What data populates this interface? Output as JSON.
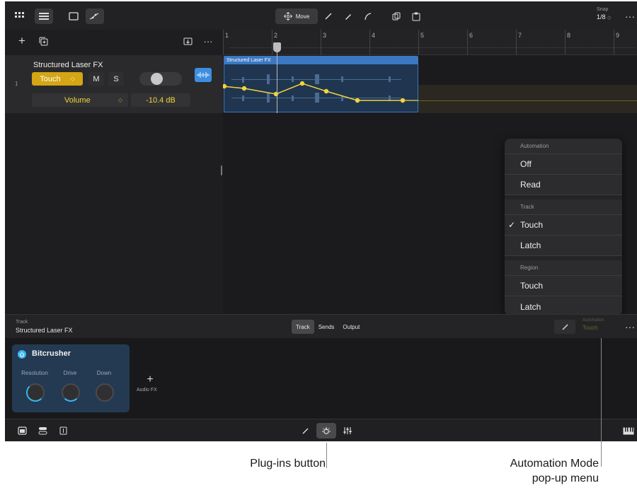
{
  "toolbar": {
    "move_label": "Move",
    "snap_label": "Snap",
    "snap_value": "1/8"
  },
  "track": {
    "number": "1",
    "name": "Structured Laser FX",
    "automation_mode": "Touch",
    "mute_label": "M",
    "solo_label": "S",
    "parameter": "Volume",
    "value": "-10.4 dB"
  },
  "ruler": {
    "bars": [
      "1",
      "2",
      "3",
      "4",
      "5",
      "6",
      "7",
      "8",
      "9"
    ]
  },
  "region": {
    "name": "Structured Laser FX"
  },
  "automation_popup": {
    "sections": [
      {
        "header": "Automation",
        "items": [
          {
            "label": "Off",
            "checked": false
          },
          {
            "label": "Read",
            "checked": false
          }
        ]
      },
      {
        "header": "Track",
        "items": [
          {
            "label": "Touch",
            "checked": true
          },
          {
            "label": "Latch",
            "checked": false
          }
        ]
      },
      {
        "header": "Region",
        "items": [
          {
            "label": "Touch",
            "checked": false
          },
          {
            "label": "Latch",
            "checked": false
          }
        ]
      }
    ],
    "checkmark": "✓"
  },
  "inspector": {
    "track_label": "Track",
    "track_name": "Structured Laser FX",
    "tabs": [
      "Track",
      "Sends",
      "Output"
    ],
    "active_tab": "Track",
    "automation_label": "Automation",
    "automation_value": "Touch"
  },
  "plugin": {
    "name": "Bitcrusher",
    "knobs": [
      "Resolution",
      "Drive",
      "Down"
    ],
    "add_label": "Audio FX"
  },
  "callouts": {
    "plugins": "Plug-ins button",
    "automation_line1": "Automation Mode",
    "automation_line2": "pop-up menu"
  },
  "colors": {
    "accent_yellow": "#f2d43a",
    "touch_button": "#d4a514",
    "region_blue": "#3b78c2",
    "power_blue": "#38b6f0"
  }
}
